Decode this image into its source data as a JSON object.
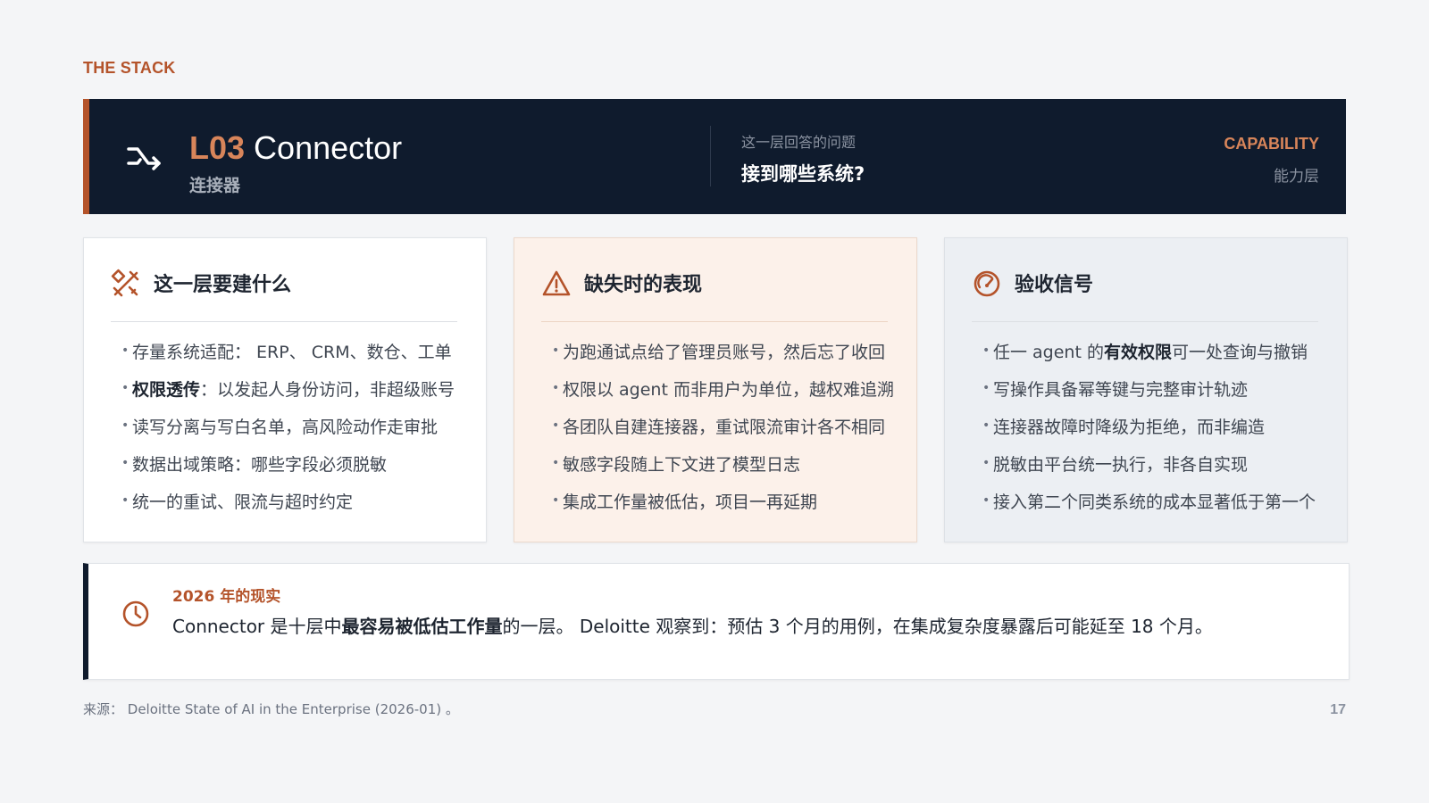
{
  "eyebrow": "THE STACK",
  "hero": {
    "code": "L03",
    "title": "Connector",
    "subtitle": "连接器",
    "question_label": "这一层回答的问题",
    "question": "接到哪些系统?",
    "category": "CAPABILITY",
    "category_sub": "能力层",
    "icon": "shuffle-icon",
    "accent": "#b4532a",
    "bg": "#0f1b2d"
  },
  "cards": [
    {
      "title": "这一层要建什么",
      "icon": "tools-icon",
      "items": [
        {
          "bold": "",
          "text": "存量系统适配： ERP、 CRM、数仓、工单"
        },
        {
          "bold": "权限透传",
          "text": "：以发起人身份访问，非超级账号"
        },
        {
          "bold": "",
          "text": "读写分离与写白名单，高风险动作走审批"
        },
        {
          "bold": "",
          "text": "数据出域策略：哪些字段必须脱敏"
        },
        {
          "bold": "",
          "text": "统一的重试、限流与超时约定"
        }
      ]
    },
    {
      "title": "缺失时的表现",
      "icon": "warning-icon",
      "items": [
        {
          "text": "为跑通试点给了管理员账号，然后忘了收回"
        },
        {
          "text": "权限以 agent 而非用户为单位，越权难追溯"
        },
        {
          "text": "各团队自建连接器，重试限流审计各不相同"
        },
        {
          "text": "敏感字段随上下文进了模型日志"
        },
        {
          "text": "集成工作量被低估，项目一再延期"
        }
      ]
    },
    {
      "title": "验收信号",
      "icon": "gauge-icon",
      "items": [
        {
          "pre": "任一 agent 的",
          "bold": "有效权限",
          "text": "可一处查询与撤销"
        },
        {
          "pre": "",
          "bold": "",
          "text": "写操作具备幂等键与完整审计轨迹"
        },
        {
          "pre": "",
          "bold": "",
          "text": "连接器故障时降级为拒绝，而非编造"
        },
        {
          "pre": "",
          "bold": "",
          "text": "脱敏由平台统一执行，非各自实现"
        },
        {
          "pre": "",
          "bold": "",
          "text": "接入第二个同类系统的成本显著低于第一个"
        }
      ]
    }
  ],
  "reality": {
    "label": "2026 年的现实",
    "icon": "clock-icon",
    "text_pre": "Connector 是十层中",
    "text_bold": "最容易被低估工作量",
    "text_post": "的一层。 Deloitte 观察到：预估 3 个月的用例，在集成复杂度暴露后可能延至 18 个月。"
  },
  "source": "来源： Deloitte State of AI in the Enterprise (2026-01) 。",
  "page_number": "17"
}
